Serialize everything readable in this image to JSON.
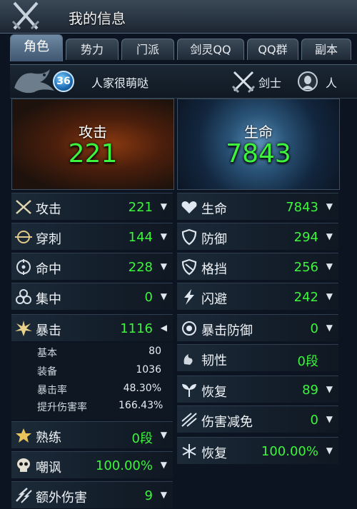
{
  "window": {
    "title": "我的信息"
  },
  "tabs": [
    {
      "label": "角色",
      "active": true
    },
    {
      "label": "势力",
      "active": false
    },
    {
      "label": "门派",
      "active": false
    },
    {
      "label": "剑灵QQ",
      "active": false
    },
    {
      "label": "QQ群",
      "active": false
    },
    {
      "label": "副本",
      "active": false
    }
  ],
  "character": {
    "level": "36",
    "name": "人家很萌哒",
    "class": "剑士",
    "race": "人"
  },
  "summary": {
    "attack": {
      "label": "攻击",
      "value": "221"
    },
    "hp": {
      "label": "生命",
      "value": "7843"
    }
  },
  "left_stats": [
    {
      "label": "攻击",
      "value": "221",
      "icon": "crossed-swords-icon",
      "arrow": "▼"
    },
    {
      "label": "穿刺",
      "value": "144",
      "icon": "pierce-icon",
      "arrow": "▼"
    },
    {
      "label": "命中",
      "value": "228",
      "icon": "crosshair-icon",
      "arrow": "▼"
    },
    {
      "label": "集中",
      "value": "0",
      "icon": "focus-icon",
      "arrow": "▼"
    },
    {
      "label": "暴击",
      "value": "1116",
      "icon": "burst-icon",
      "arrow": "◀"
    },
    {
      "label": "熟练",
      "value": "0段",
      "icon": "star-icon",
      "arrow": "▼"
    },
    {
      "label": "嘲讽",
      "value": "100.00%",
      "icon": "skull-icon",
      "arrow": "▼"
    },
    {
      "label": "额外伤害",
      "value": "9",
      "icon": "extra-damage-icon",
      "arrow": "▼"
    }
  ],
  "crit_details": [
    {
      "label": "基本",
      "value": "80"
    },
    {
      "label": "装备",
      "value": "1036"
    },
    {
      "label": "暴击率",
      "value": "48.30%"
    },
    {
      "label": "提升伤害率",
      "value": "166.43%"
    }
  ],
  "right_stats": [
    {
      "label": "生命",
      "value": "7843",
      "icon": "heart-icon",
      "arrow": "▼"
    },
    {
      "label": "防御",
      "value": "294",
      "icon": "shield-icon",
      "arrow": "▼"
    },
    {
      "label": "格挡",
      "value": "256",
      "icon": "block-icon",
      "arrow": "▼"
    },
    {
      "label": "闪避",
      "value": "242",
      "icon": "lightning-icon",
      "arrow": "▼"
    },
    {
      "label": "暴击防御",
      "value": "0",
      "icon": "crit-defense-icon",
      "arrow": "▼"
    },
    {
      "label": "韧性",
      "value": "0段",
      "icon": "toughness-icon",
      "arrow": ""
    },
    {
      "label": "恢复",
      "value": "89",
      "icon": "sprout-icon",
      "arrow": "▼"
    },
    {
      "label": "伤害减免",
      "value": "0",
      "icon": "damage-reduction-icon",
      "arrow": "▼"
    },
    {
      "label": "恢复",
      "value": "100.00%",
      "icon": "snowflake-icon",
      "arrow": "▼"
    }
  ],
  "colors": {
    "value_green": "#3df53d",
    "panel_dark": "#131e2a"
  }
}
